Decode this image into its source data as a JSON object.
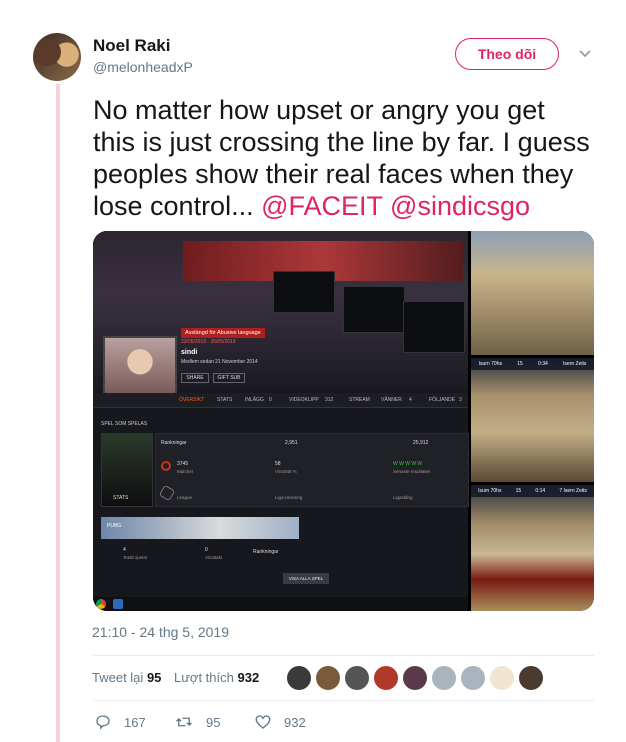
{
  "tweet": {
    "author_name": "Noel Raki",
    "author_handle": "@melonheadxP",
    "follow_label": "Theo dõi",
    "text_line1": "No matter how upset or angry you get",
    "text_line2": "this is just crossing the line by far. I guess",
    "text_line3": "peoples show their real faces when they",
    "text_line4": "lose control...",
    "mention1": "@FACEIT",
    "mention2": "@sindicsgo",
    "timestamp": "21:10 - 24 thg 5, 2019"
  },
  "stats": {
    "retweets_label": "Tweet lại",
    "retweets_count": "95",
    "likes_label": "Lượt thích",
    "likes_count": "932",
    "liker_colors": [
      "#3a3a3a",
      "#7a5a3a",
      "#555555",
      "#b03a2a",
      "#5a3a4a",
      "#aab4be",
      "#aab4be",
      "#f0e6d0",
      "#4a3a30"
    ]
  },
  "actions": {
    "reply_count": "167",
    "retweet_count": "95",
    "like_count": "932"
  },
  "faceit": {
    "ban_tag": "Avstängd för Abusive language",
    "ban_dates": "23/05/2019 - 25/05/2019",
    "username": "sindi",
    "member_since": "Medlem sedan 21 November 2014",
    "share_label": "SHARE",
    "gift_label": "GIFT SUB",
    "nav": [
      "ÖVERSIKT",
      "STATS",
      "INLÄGG",
      "VIDEOKLIPP",
      "STREAM",
      "VÄNNER",
      "FÖLJANDE"
    ],
    "nav_counts": [
      "0",
      "312",
      "4",
      "3"
    ],
    "section_title": "SPEL SOM SPELAS",
    "rankings_label": "Rankningar",
    "rank_value": "2,951",
    "eu_value": "25,912",
    "matches_value": "3745",
    "matches_label": "Matcher",
    "win_value": "58",
    "win_label": "Vinstratt %",
    "recent_results": "W W W W W",
    "recent_label": "Senaste resultaten",
    "league_label": "League",
    "league_rank_label": "Liga-rankning",
    "league_tier_label": "Ligastång",
    "stats_btn": "STATS",
    "pubg_label": "PUBG",
    "pubg_total_value": "4",
    "pubg_total_label": "Totalt spelat",
    "pubg_wins_value": "0",
    "pubg_wins_label": "Vinsttakt",
    "pubg_rank_label": "Rankningar",
    "show_all": "VISA ALLA SPEL"
  },
  "hud": [
    {
      "left": "Isurn 70hs",
      "score": "15",
      "time": "0:34",
      "right": "Isern Zeits"
    },
    {
      "left": "Isurn 70hs",
      "score": "15",
      "time": "0:14",
      "right": "7  Isern Zeits"
    }
  ],
  "colors": {
    "accent": "#e0245e",
    "muted": "#657786",
    "faceit_orange": "#ff5a1f"
  }
}
